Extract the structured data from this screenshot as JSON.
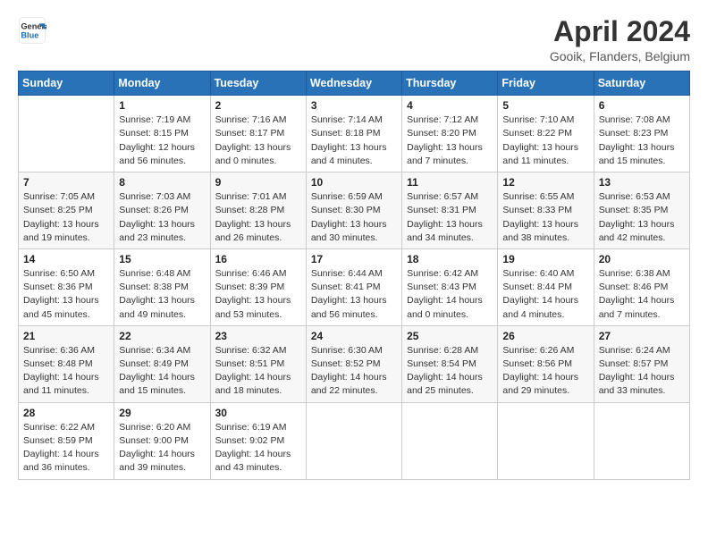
{
  "header": {
    "logo_line1": "General",
    "logo_line2": "Blue",
    "title": "April 2024",
    "subtitle": "Gooik, Flanders, Belgium"
  },
  "weekdays": [
    "Sunday",
    "Monday",
    "Tuesday",
    "Wednesday",
    "Thursday",
    "Friday",
    "Saturday"
  ],
  "weeks": [
    [
      {
        "day": "",
        "info": ""
      },
      {
        "day": "1",
        "info": "Sunrise: 7:19 AM\nSunset: 8:15 PM\nDaylight: 12 hours\nand 56 minutes."
      },
      {
        "day": "2",
        "info": "Sunrise: 7:16 AM\nSunset: 8:17 PM\nDaylight: 13 hours\nand 0 minutes."
      },
      {
        "day": "3",
        "info": "Sunrise: 7:14 AM\nSunset: 8:18 PM\nDaylight: 13 hours\nand 4 minutes."
      },
      {
        "day": "4",
        "info": "Sunrise: 7:12 AM\nSunset: 8:20 PM\nDaylight: 13 hours\nand 7 minutes."
      },
      {
        "day": "5",
        "info": "Sunrise: 7:10 AM\nSunset: 8:22 PM\nDaylight: 13 hours\nand 11 minutes."
      },
      {
        "day": "6",
        "info": "Sunrise: 7:08 AM\nSunset: 8:23 PM\nDaylight: 13 hours\nand 15 minutes."
      }
    ],
    [
      {
        "day": "7",
        "info": "Sunrise: 7:05 AM\nSunset: 8:25 PM\nDaylight: 13 hours\nand 19 minutes."
      },
      {
        "day": "8",
        "info": "Sunrise: 7:03 AM\nSunset: 8:26 PM\nDaylight: 13 hours\nand 23 minutes."
      },
      {
        "day": "9",
        "info": "Sunrise: 7:01 AM\nSunset: 8:28 PM\nDaylight: 13 hours\nand 26 minutes."
      },
      {
        "day": "10",
        "info": "Sunrise: 6:59 AM\nSunset: 8:30 PM\nDaylight: 13 hours\nand 30 minutes."
      },
      {
        "day": "11",
        "info": "Sunrise: 6:57 AM\nSunset: 8:31 PM\nDaylight: 13 hours\nand 34 minutes."
      },
      {
        "day": "12",
        "info": "Sunrise: 6:55 AM\nSunset: 8:33 PM\nDaylight: 13 hours\nand 38 minutes."
      },
      {
        "day": "13",
        "info": "Sunrise: 6:53 AM\nSunset: 8:35 PM\nDaylight: 13 hours\nand 42 minutes."
      }
    ],
    [
      {
        "day": "14",
        "info": "Sunrise: 6:50 AM\nSunset: 8:36 PM\nDaylight: 13 hours\nand 45 minutes."
      },
      {
        "day": "15",
        "info": "Sunrise: 6:48 AM\nSunset: 8:38 PM\nDaylight: 13 hours\nand 49 minutes."
      },
      {
        "day": "16",
        "info": "Sunrise: 6:46 AM\nSunset: 8:39 PM\nDaylight: 13 hours\nand 53 minutes."
      },
      {
        "day": "17",
        "info": "Sunrise: 6:44 AM\nSunset: 8:41 PM\nDaylight: 13 hours\nand 56 minutes."
      },
      {
        "day": "18",
        "info": "Sunrise: 6:42 AM\nSunset: 8:43 PM\nDaylight: 14 hours\nand 0 minutes."
      },
      {
        "day": "19",
        "info": "Sunrise: 6:40 AM\nSunset: 8:44 PM\nDaylight: 14 hours\nand 4 minutes."
      },
      {
        "day": "20",
        "info": "Sunrise: 6:38 AM\nSunset: 8:46 PM\nDaylight: 14 hours\nand 7 minutes."
      }
    ],
    [
      {
        "day": "21",
        "info": "Sunrise: 6:36 AM\nSunset: 8:48 PM\nDaylight: 14 hours\nand 11 minutes."
      },
      {
        "day": "22",
        "info": "Sunrise: 6:34 AM\nSunset: 8:49 PM\nDaylight: 14 hours\nand 15 minutes."
      },
      {
        "day": "23",
        "info": "Sunrise: 6:32 AM\nSunset: 8:51 PM\nDaylight: 14 hours\nand 18 minutes."
      },
      {
        "day": "24",
        "info": "Sunrise: 6:30 AM\nSunset: 8:52 PM\nDaylight: 14 hours\nand 22 minutes."
      },
      {
        "day": "25",
        "info": "Sunrise: 6:28 AM\nSunset: 8:54 PM\nDaylight: 14 hours\nand 25 minutes."
      },
      {
        "day": "26",
        "info": "Sunrise: 6:26 AM\nSunset: 8:56 PM\nDaylight: 14 hours\nand 29 minutes."
      },
      {
        "day": "27",
        "info": "Sunrise: 6:24 AM\nSunset: 8:57 PM\nDaylight: 14 hours\nand 33 minutes."
      }
    ],
    [
      {
        "day": "28",
        "info": "Sunrise: 6:22 AM\nSunset: 8:59 PM\nDaylight: 14 hours\nand 36 minutes."
      },
      {
        "day": "29",
        "info": "Sunrise: 6:20 AM\nSunset: 9:00 PM\nDaylight: 14 hours\nand 39 minutes."
      },
      {
        "day": "30",
        "info": "Sunrise: 6:19 AM\nSunset: 9:02 PM\nDaylight: 14 hours\nand 43 minutes."
      },
      {
        "day": "",
        "info": ""
      },
      {
        "day": "",
        "info": ""
      },
      {
        "day": "",
        "info": ""
      },
      {
        "day": "",
        "info": ""
      }
    ]
  ]
}
